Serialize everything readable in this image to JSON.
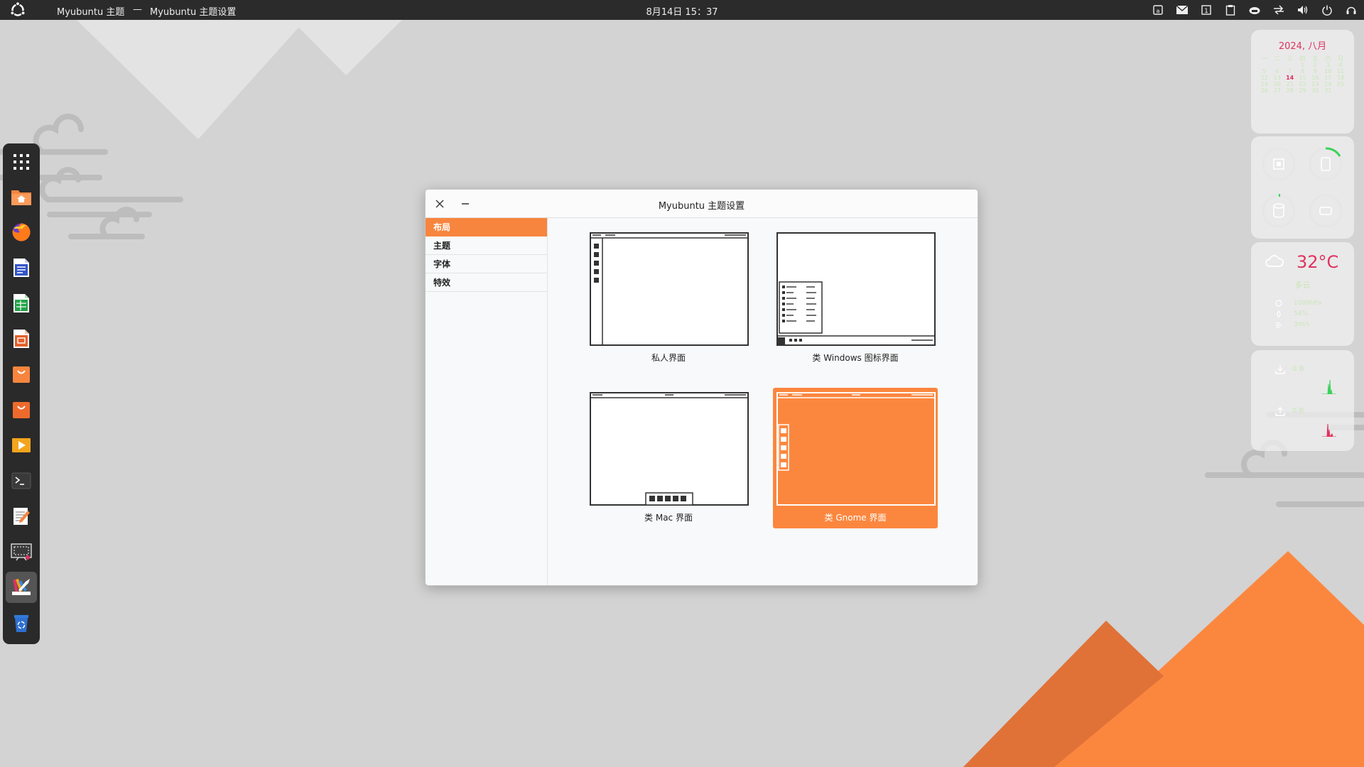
{
  "topbar": {
    "app_title": "Myubuntu 主题",
    "separator": "—",
    "window_title": "Myubuntu 主题设置",
    "clock": "8月14日  15：37",
    "tray_icons": [
      "app-indicator-icon",
      "mail-icon",
      "workspace-icon",
      "clipboard-icon",
      "cloud-icon",
      "network-icon",
      "volume-icon",
      "power-icon",
      "headset-icon"
    ]
  },
  "dock": {
    "items": [
      {
        "name": "app-grid",
        "icon": "grid-icon"
      },
      {
        "name": "files",
        "icon": "home-folder-icon"
      },
      {
        "name": "firefox",
        "icon": "firefox-icon"
      },
      {
        "name": "writer",
        "icon": "document-icon"
      },
      {
        "name": "calc",
        "icon": "spreadsheet-icon"
      },
      {
        "name": "impress",
        "icon": "presentation-icon"
      },
      {
        "name": "software-center",
        "icon": "shopping-bag-icon"
      },
      {
        "name": "app-store",
        "icon": "shopping-bag-icon"
      },
      {
        "name": "video-player",
        "icon": "play-icon"
      },
      {
        "name": "terminal",
        "icon": "terminal-icon"
      },
      {
        "name": "text-editor",
        "icon": "text-editor-icon"
      },
      {
        "name": "screenshot",
        "icon": "screenshot-icon"
      },
      {
        "name": "theme-settings",
        "icon": "paint-brush-icon"
      },
      {
        "name": "trash",
        "icon": "trash-icon"
      }
    ]
  },
  "calendar": {
    "title": "2024, 八月",
    "weekdays": [
      "一",
      "二",
      "三",
      "四",
      "五",
      "六",
      "日"
    ],
    "days": [
      "",
      "",
      "",
      "1",
      "2",
      "3",
      "4",
      "5",
      "6",
      "7",
      "8",
      "9",
      "10",
      "11",
      "12",
      "13",
      "14",
      "15",
      "16",
      "17",
      "18",
      "19",
      "20",
      "21",
      "22",
      "23",
      "24",
      "25",
      "26",
      "27",
      "28",
      "29",
      "30",
      "31",
      ""
    ],
    "today": "14"
  },
  "weather": {
    "temp": "32°C",
    "condition": "多云",
    "humidity": "1009hPa",
    "pressure": "54%",
    "wind": "3m/s"
  },
  "network": {
    "down": "0 B",
    "up": "0 B"
  },
  "dialog": {
    "title": "Myubuntu 主题设置",
    "nav": [
      "布局",
      "主题",
      "字体",
      "特效"
    ],
    "layouts": [
      {
        "label": "私人界面"
      },
      {
        "label": "类 Windows 图标界面"
      },
      {
        "label": "类 Mac 界面"
      },
      {
        "label": "类 Gnome 界面"
      }
    ]
  },
  "colors": {
    "accent": "#f7853e",
    "calendar_accent": "#e0325f",
    "topbar": "#2b2b2b",
    "dock": "#2a2a2a"
  }
}
